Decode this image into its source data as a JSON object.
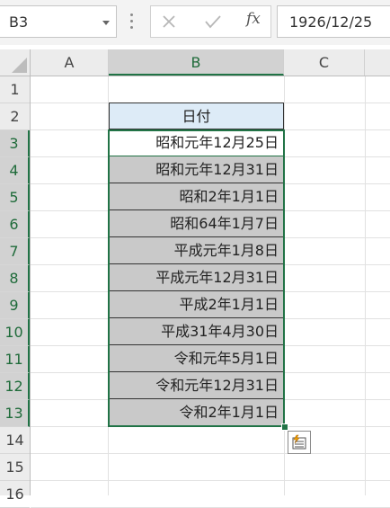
{
  "formula_bar": {
    "name_box": "B3",
    "cancel_icon": "close-icon",
    "enter_icon": "check-icon",
    "function_label": "fx",
    "formula_value": "1926/12/25"
  },
  "columns": [
    "A",
    "B",
    "C"
  ],
  "rows": [
    "1",
    "2",
    "3",
    "4",
    "5",
    "6",
    "7",
    "8",
    "9",
    "10",
    "11",
    "12",
    "13",
    "14",
    "15",
    "16"
  ],
  "active_cell": "B3",
  "column_b": {
    "header": "日付",
    "values": [
      "昭和元年12月25日",
      "昭和元年12月31日",
      "昭和2年1月1日",
      "昭和64年1月7日",
      "平成元年1月8日",
      "平成元年12月31日",
      "平成2年1月1日",
      "平成31年4月30日",
      "令和元年5月1日",
      "令和元年12月31日",
      "令和2年1月1日"
    ]
  },
  "colors": {
    "accent": "#217346",
    "header_fill": "#ddebf7",
    "data_fill": "#c9c9c9"
  },
  "quick_analysis_icon": "quick-analysis-icon"
}
